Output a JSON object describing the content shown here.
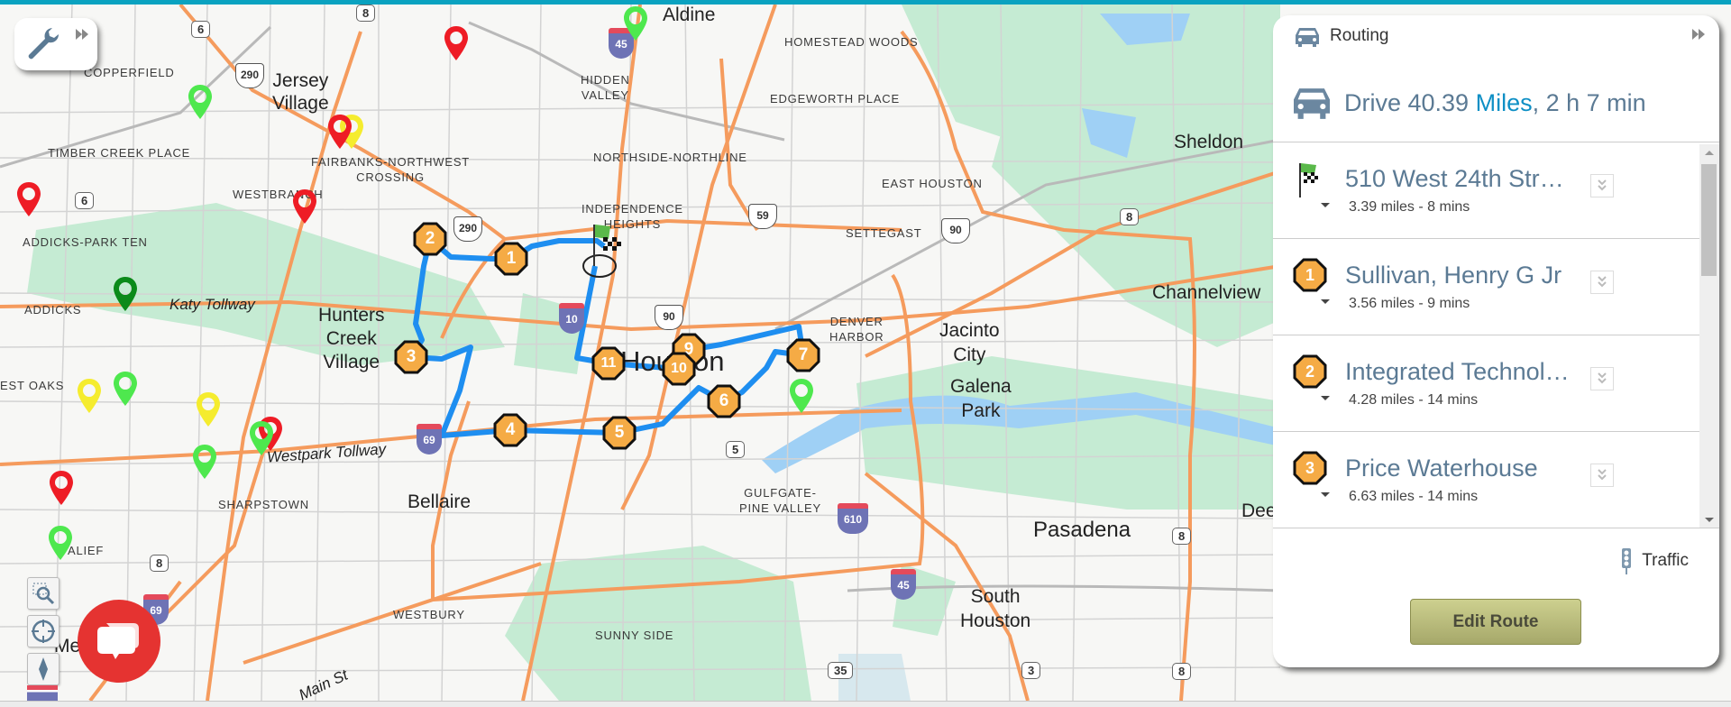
{
  "toolbar": {
    "tools_icon": "wrench-icon",
    "expand_icon": "double-chevron-right-icon"
  },
  "map_controls": {
    "zoom_box_icon": "zoom-region-icon",
    "locate_icon": "crosshair-icon",
    "compass_icon": "compass-icon",
    "chat_icon": "chat-bubbles-icon"
  },
  "map": {
    "place_labels": {
      "copperfield": "COPPERFIELD",
      "jersey_village": "Jersey Village",
      "jersey": "Jersey",
      "village": "Village",
      "timber_creek": "TIMBER CREEK PLACE",
      "fairbanks_1": "FAIRBANKS-NORTHWEST",
      "fairbanks_2": "CROSSING",
      "westbranch": "WESTBRANCH",
      "addicks_park_ten": "ADDICKS-PARK TEN",
      "addicks": "ADDICKS",
      "katy_tollway": "Katy Tollway",
      "hunters_1": "Hunters",
      "hunters_2": "Creek",
      "hunters_3": "Village",
      "west_oaks": "EST OAKS",
      "westpark": "Westpark Tollway",
      "sharpstown": "SHARPSTOWN",
      "bellaire": "Bellaire",
      "alief": "ALIEF",
      "westbury": "WESTBURY",
      "main_st": "Main St",
      "sunny_side": "SUNNY SIDE",
      "gulfgate_1": "GULFGATE-",
      "gulfgate_2": "PINE VALLEY",
      "aldine": "Aldine",
      "homestead": "HOMESTEAD WOODS",
      "hidden_1": "HIDDEN",
      "hidden_2": "VALLEY",
      "edgeworth": "EDGEWORTH PLACE",
      "northside": "NORTHSIDE-NORTHLINE",
      "east_houston": "EAST HOUSTON",
      "independence_1": "INDEPENDENCE",
      "independence_2": "HEIGHTS",
      "settegast": "SETTEGAST",
      "houston": "Houston",
      "denver_1": "DENVER",
      "denver_2": "HARBOR",
      "jacinto_1": "Jacinto",
      "jacinto_2": "City",
      "galena_1": "Galena",
      "galena_2": "Park",
      "sheldon": "Sheldon",
      "channelview": "Channelview",
      "pasadena": "Pasadena",
      "south_1": "South",
      "south_2": "Houston",
      "deer": "Dee",
      "meadows": "Mead"
    },
    "shields": {
      "sr6_a": "6",
      "sr6_b": "6",
      "sr8_top": "8",
      "sr8_right": "8",
      "sr8_b1": "8",
      "sr8_b2": "8",
      "sr8_left": "8",
      "us290_a": "290",
      "us290_b": "290",
      "us59": "59",
      "us90_a": "90",
      "us90_b": "90",
      "i45_top": "45",
      "i45_bot": "45",
      "i10": "10",
      "i69_a": "69",
      "i69_b": "69",
      "i610": "610",
      "sr5": "5",
      "sr35": "35",
      "sr3": "3"
    },
    "route_stops": [
      "1",
      "2",
      "3",
      "4",
      "5",
      "6",
      "7",
      "9",
      "10",
      "11"
    ],
    "route_color": "#1e8ef0",
    "stop_color": "#f5ab45"
  },
  "routing_panel": {
    "title": "Routing",
    "header_icon": "car-icon",
    "collapse_icon": "double-chevron-right-icon",
    "summary": {
      "prefix": "Drive 40.39 ",
      "unit": "Miles",
      "suffix": ", 2 h 7 min"
    },
    "stops": [
      {
        "marker": "start-flag",
        "name": "510 West 24th Str…",
        "meta": "3.39 miles - 8 mins"
      },
      {
        "marker": "1",
        "name": "Sullivan, Henry G Jr",
        "meta": "3.56 miles - 9 mins"
      },
      {
        "marker": "2",
        "name": "Integrated Technol…",
        "meta": "4.28 miles - 14 mins"
      },
      {
        "marker": "3",
        "name": "Price Waterhouse",
        "meta": "6.63 miles - 14 mins"
      }
    ],
    "traffic_label": "Traffic",
    "edit_route_label": "Edit Route"
  }
}
